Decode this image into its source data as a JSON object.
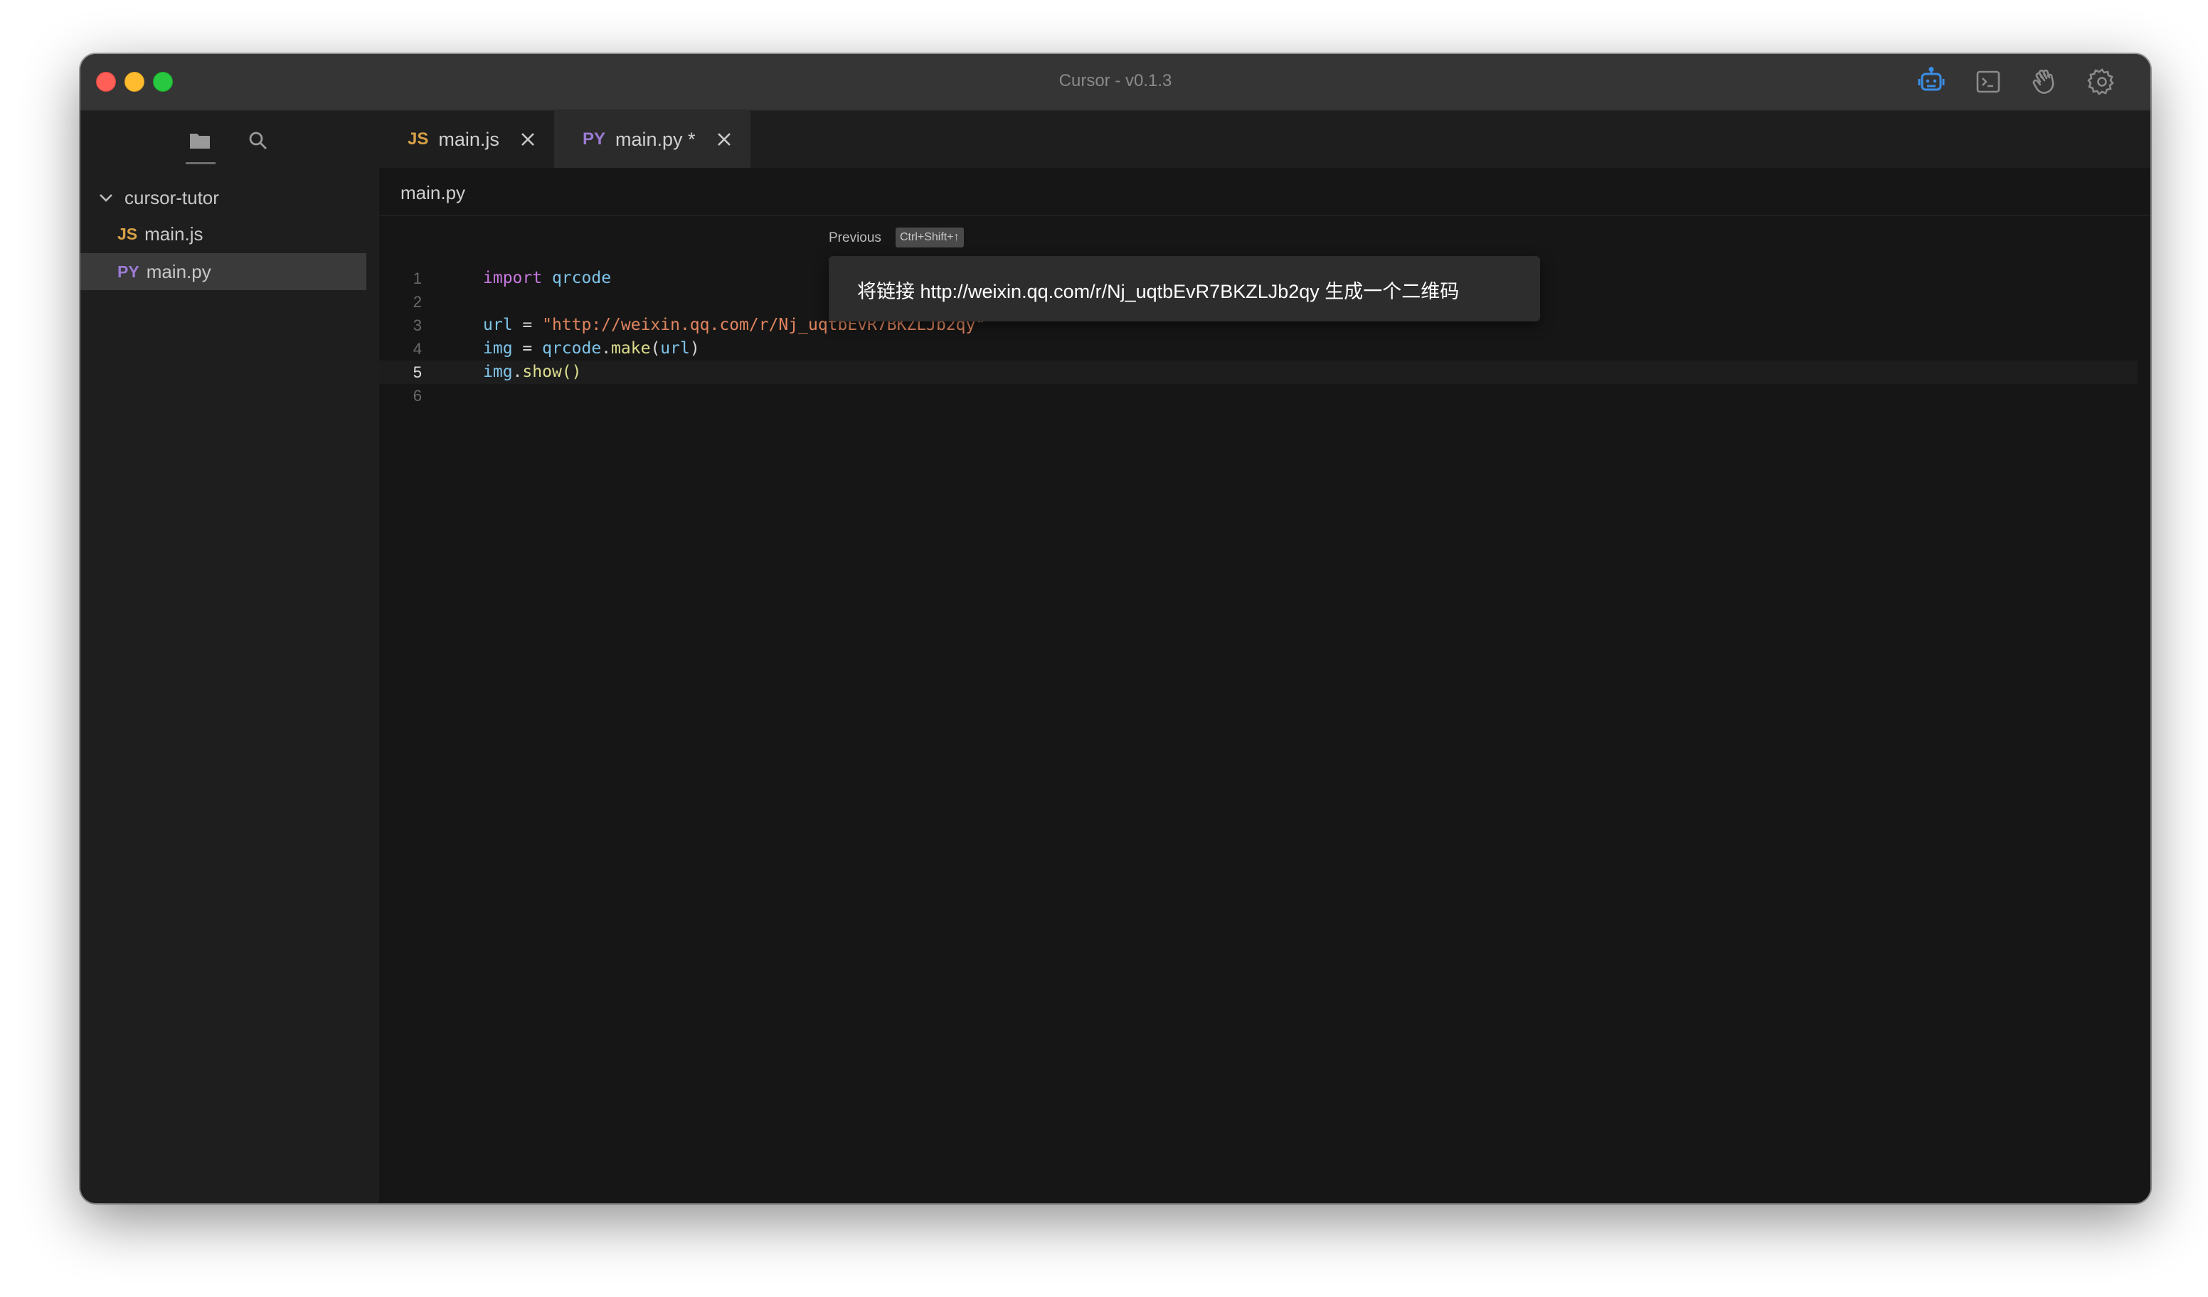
{
  "window": {
    "title": "Cursor - v0.1.3"
  },
  "toolbar": {
    "icons": [
      "robot-icon",
      "terminal-icon",
      "hand-icon",
      "gear-icon"
    ],
    "accent": "#3a8ee6"
  },
  "sidebar": {
    "folder": "cursor-tutor",
    "files": [
      {
        "ext": "JS",
        "name": "main.js",
        "ext_color": "#d7a147"
      },
      {
        "ext": "PY",
        "name": "main.py",
        "ext_color": "#9b7bd4"
      }
    ]
  },
  "tabs": [
    {
      "ext": "JS",
      "label": "main.js"
    },
    {
      "ext": "PY",
      "label": "main.py *"
    }
  ],
  "editor": {
    "breadcrumb": "main.py",
    "line_numbers": [
      "1",
      "2",
      "3",
      "4",
      "5",
      "6"
    ],
    "current_line": 5
  },
  "prompt": {
    "previous_label": "Previous",
    "shortcut": "Ctrl+Shift+↑",
    "text": "将链接 http://weixin.qq.com/r/Nj_uqtbEvR7BKZLJb2qy 生成一个二维码"
  }
}
